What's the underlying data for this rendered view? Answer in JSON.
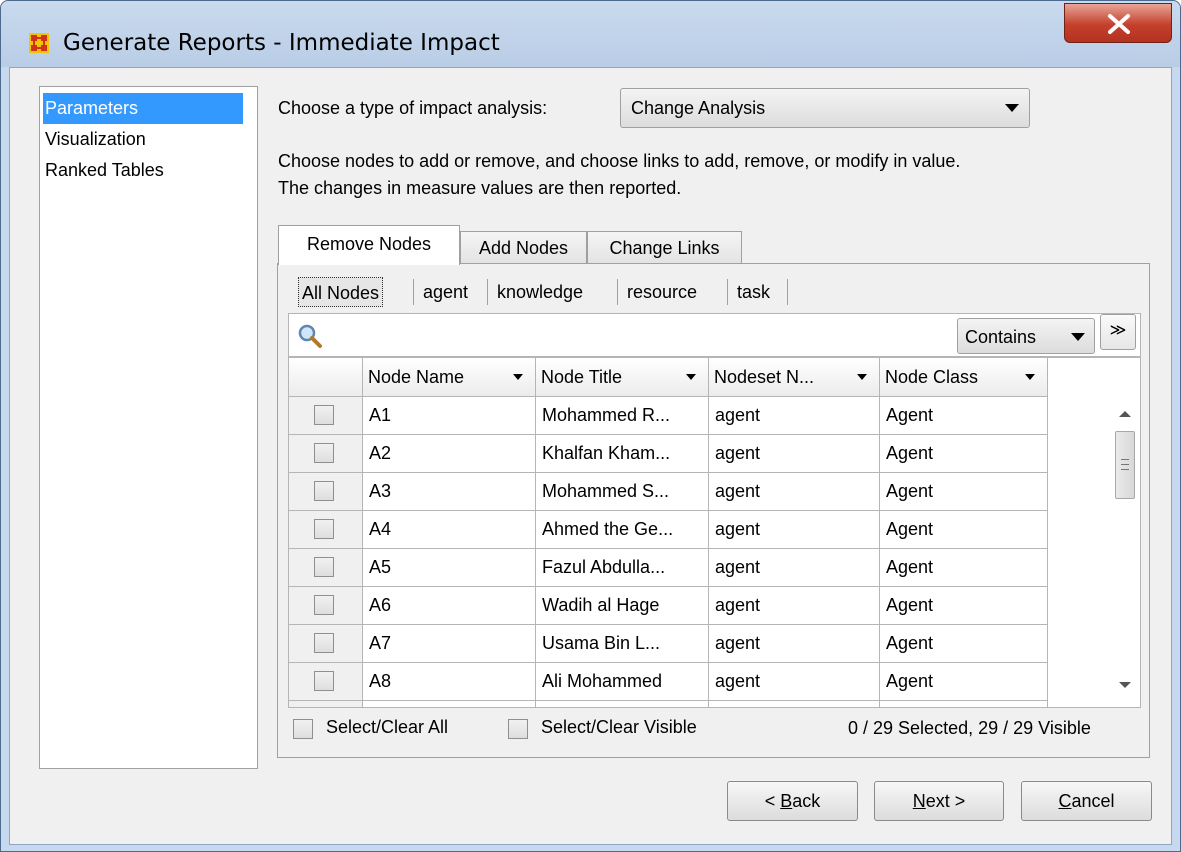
{
  "window": {
    "title": "Generate Reports - Immediate Impact"
  },
  "nav": {
    "items": [
      "Parameters",
      "Visualization",
      "Ranked Tables"
    ],
    "selected": "Parameters"
  },
  "analysis": {
    "label": "Choose a type of impact analysis:",
    "selected": "Change Analysis",
    "description_line1": "Choose nodes to add or remove, and choose links to add, remove, or modify in value.",
    "description_line2": "The changes in measure values are then reported."
  },
  "tabs": [
    "Remove Nodes",
    "Add Nodes",
    "Change Links"
  ],
  "subtabs": [
    "All Nodes",
    "agent",
    "knowledge",
    "resource",
    "task"
  ],
  "filter": {
    "mode": "Contains",
    "expand_glyph": "≫",
    "search_icon": "magnifier-icon"
  },
  "table": {
    "columns": [
      "Node Name",
      "Node Title",
      "Nodeset N...",
      "Node Class"
    ],
    "rows": [
      {
        "name": "A1",
        "title": "Mohammed R...",
        "nodeset": "agent",
        "cls": "Agent"
      },
      {
        "name": "A2",
        "title": "Khalfan Kham...",
        "nodeset": "agent",
        "cls": "Agent"
      },
      {
        "name": "A3",
        "title": "Mohammed S...",
        "nodeset": "agent",
        "cls": "Agent"
      },
      {
        "name": "A4",
        "title": "Ahmed the Ge...",
        "nodeset": "agent",
        "cls": "Agent"
      },
      {
        "name": "A5",
        "title": "Fazul Abdulla...",
        "nodeset": "agent",
        "cls": "Agent"
      },
      {
        "name": "A6",
        "title": "Wadih al Hage",
        "nodeset": "agent",
        "cls": "Agent"
      },
      {
        "name": "A7",
        "title": "Usama Bin L...",
        "nodeset": "agent",
        "cls": "Agent"
      },
      {
        "name": "A8",
        "title": "Ali Mohammed",
        "nodeset": "agent",
        "cls": "Agent"
      }
    ]
  },
  "footer": {
    "select_all": "Select/Clear All",
    "select_visible": "Select/Clear Visible",
    "status": "0 / 29 Selected, 29 / 29 Visible"
  },
  "buttons": {
    "back": {
      "pre": "< ",
      "mnemonic": "B",
      "post": "ack"
    },
    "next": {
      "pre": "",
      "mnemonic": "N",
      "post": "ext >"
    },
    "cancel": {
      "pre": "",
      "mnemonic": "C",
      "post": "ancel"
    }
  }
}
